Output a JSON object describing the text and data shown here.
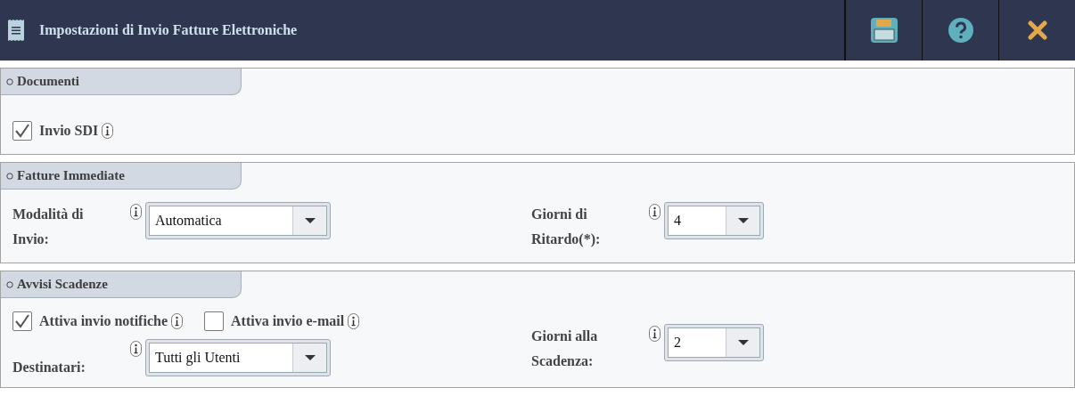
{
  "window": {
    "title": "Impostazioni di Invio Fatture Elettroniche"
  },
  "toolbar": [
    {
      "kind": "save"
    },
    {
      "kind": "help"
    },
    {
      "kind": "close"
    }
  ],
  "sections": [
    {
      "title": "Documenti",
      "kind": "single",
      "columns": [
        {
          "rows": [
            {
              "items": [
                {
                  "kind": "checkbox",
                  "label": "Invio SDI",
                  "checked": true
                }
              ]
            }
          ]
        }
      ]
    },
    {
      "title": "Fatture Immediate",
      "kind": "pair",
      "columns": [
        {
          "rows": [
            {
              "items": [
                {
                  "kind": "select",
                  "label": "Modalità di Invio:",
                  "value": "Automatica"
                }
              ]
            }
          ]
        },
        {
          "rows": [
            {
              "items": [
                {
                  "kind": "select",
                  "label": "Giorni di Ritardo(*):",
                  "value": "4"
                }
              ]
            }
          ]
        }
      ]
    },
    {
      "title": "Avvisi Scadenze",
      "kind": "pair",
      "columns": [
        {
          "rows": [
            {
              "items": [
                {
                  "kind": "checkbox",
                  "label": "Attiva invio notifiche",
                  "checked": true
                },
                {
                  "kind": "checkbox",
                  "label": "Attiva invio e-mail",
                  "checked": false
                }
              ]
            },
            {
              "items": [
                {
                  "kind": "select",
                  "label": "Destinatari:",
                  "value": "Tutti gli Utenti"
                }
              ]
            }
          ]
        },
        {
          "rows": [
            {
              "items": [
                {
                  "kind": "select",
                  "label": "Giorni alla Scadenza:",
                  "value": "2"
                }
              ]
            }
          ]
        }
      ]
    }
  ]
}
